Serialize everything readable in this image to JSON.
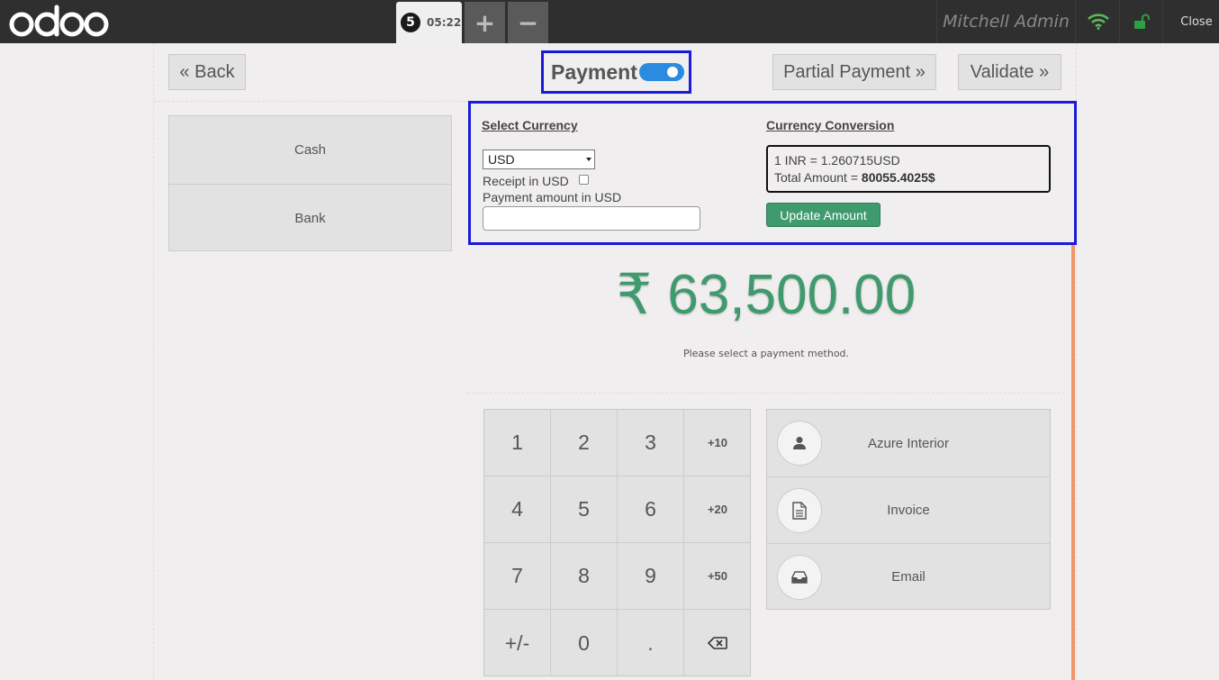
{
  "topbar": {
    "logo": "odoo",
    "order_number": "5",
    "order_time": "05:22",
    "add_label": "+",
    "remove_label": "−",
    "user": "Mitchell Admin",
    "close_label": "Close"
  },
  "header": {
    "back_label": "« Back",
    "title": "Payment",
    "toggle_on": true,
    "partial_payment_label": "Partial Payment »",
    "validate_label": "Validate »"
  },
  "payment_methods": [
    "Cash",
    "Bank"
  ],
  "currency": {
    "select_heading": "Select Currency",
    "selected_currency": "USD",
    "receipt_label": "Receipt in USD",
    "amount_label": "Payment amount in USD",
    "amount_value": "",
    "conversion_heading": "Currency Conversion",
    "rate_line": "1 INR = 1.260715USD",
    "total_prefix": "Total Amount = ",
    "total_value": "80055.4025$",
    "update_label": "Update Amount"
  },
  "total": {
    "amount": "₹ 63,500.00",
    "hint": "Please select a payment method."
  },
  "numpad": {
    "keys": [
      "1",
      "2",
      "3",
      "+10",
      "4",
      "5",
      "6",
      "+20",
      "7",
      "8",
      "9",
      "+50",
      "+/-",
      "0",
      ".",
      "⌫"
    ]
  },
  "side": {
    "customer_label": "Azure Interior",
    "invoice_label": "Invoice",
    "email_label": "Email"
  },
  "colors": {
    "topbar": "#2f2f2f",
    "accent_green": "#3f9a6e",
    "highlight_blue": "#1a1adb",
    "toggle_blue": "#2b8be0",
    "orange": "#f0956b"
  }
}
